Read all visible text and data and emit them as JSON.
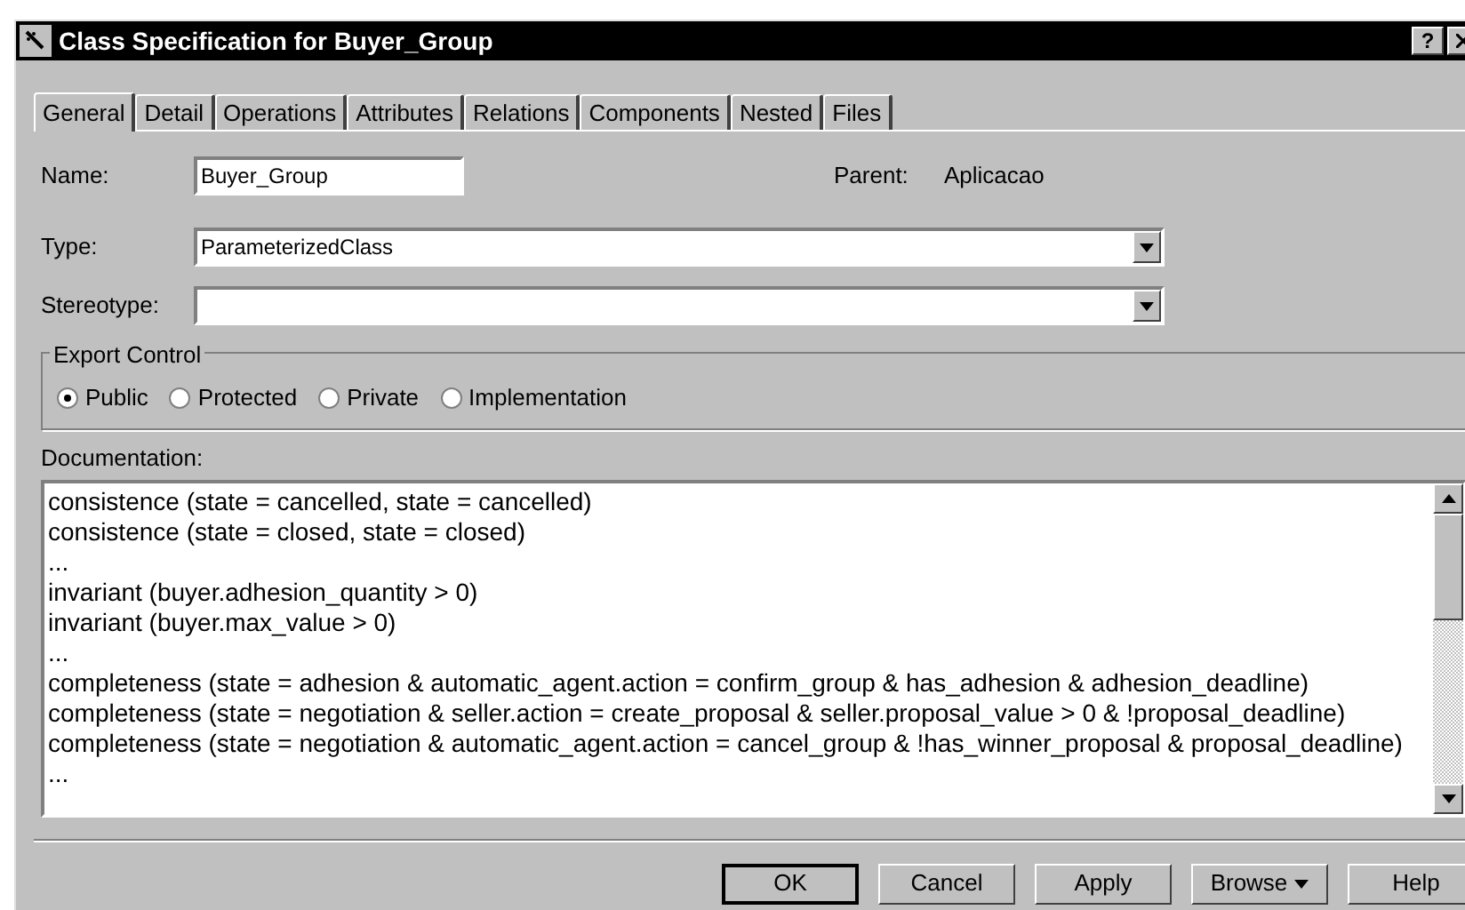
{
  "window": {
    "title": "Class Specification for Buyer_Group",
    "help_button": "?"
  },
  "tabs": [
    {
      "label": "General",
      "selected": true
    },
    {
      "label": "Detail",
      "selected": false
    },
    {
      "label": "Operations",
      "selected": false
    },
    {
      "label": "Attributes",
      "selected": false
    },
    {
      "label": "Relations",
      "selected": false
    },
    {
      "label": "Components",
      "selected": false
    },
    {
      "label": "Nested",
      "selected": false
    },
    {
      "label": "Files",
      "selected": false
    }
  ],
  "name": {
    "label": "Name:",
    "value": "Buyer_Group"
  },
  "parent": {
    "label": "Parent:",
    "value": "Aplicacao"
  },
  "type": {
    "label": "Type:",
    "value": "ParameterizedClass"
  },
  "stereotype": {
    "label": "Stereotype:"
  },
  "export_control": {
    "label": "Export Control",
    "options": [
      {
        "label": "Public",
        "selected": true
      },
      {
        "label": "Protected",
        "selected": false
      },
      {
        "label": "Private",
        "selected": false
      },
      {
        "label": "Implementation",
        "selected": false
      }
    ]
  },
  "documentation": {
    "label": "Documentation:",
    "lines": [
      "consistence (state = cancelled, state = cancelled)",
      "consistence (state = closed, state = closed)",
      "...",
      "invariant (buyer.adhesion_quantity > 0)",
      "invariant (buyer.max_value > 0)",
      "...",
      "completeness (state = adhesion & automatic_agent.action = confirm_group & has_adhesion & adhesion_deadline)",
      "completeness (state = negotiation & seller.action = create_proposal & seller.proposal_value > 0 & !proposal_deadline)",
      "completeness (state = negotiation & automatic_agent.action = cancel_group & !has_winner_proposal & proposal_deadline)",
      "..."
    ]
  },
  "buttons": [
    {
      "label": "OK",
      "kind": "default"
    },
    {
      "label": "Cancel",
      "kind": "plain"
    },
    {
      "label": "Apply",
      "kind": "plain"
    },
    {
      "label": "Browse",
      "kind": "menu"
    },
    {
      "label": "Help",
      "kind": "plain"
    }
  ]
}
